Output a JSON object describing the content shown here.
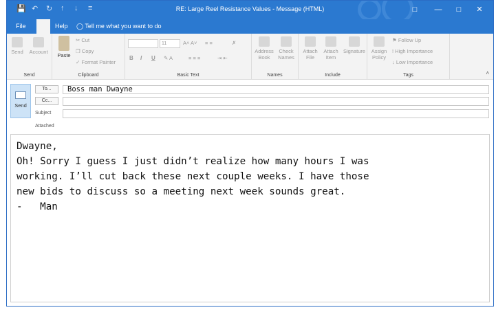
{
  "window": {
    "title": "RE: Large Reel Resistance Values - Message (HTML)",
    "quick_access": [
      "save-icon",
      "undo-icon",
      "redo-icon",
      "up-arrow-icon",
      "down-arrow-icon",
      "customize-icon"
    ],
    "accent_color": "#2b79d0"
  },
  "tabs": {
    "file": "File",
    "help": "Help",
    "tell_me": "Tell me what you want to do"
  },
  "ribbon": {
    "send_group": {
      "label": "Send",
      "send": "Send",
      "account": "Account"
    },
    "clipboard": {
      "label": "Clipboard",
      "paste": "Paste",
      "cut": "Cut",
      "copy": "Copy",
      "format_painter": "Format Painter"
    },
    "basic_text": {
      "label": "Basic Text",
      "font_size": "11",
      "bold": "B",
      "italic": "I",
      "underline": "U"
    },
    "names": {
      "label": "Names",
      "address_book_1": "Address",
      "address_book_2": "Book",
      "check_names_1": "Check",
      "check_names_2": "Names"
    },
    "include": {
      "label": "Include",
      "attach_file_1": "Attach",
      "attach_file_2": "File",
      "attach_item_1": "Attach",
      "attach_item_2": "Item",
      "signature": "Signature"
    },
    "tags": {
      "label": "Tags",
      "assign_policy_1": "Assign",
      "assign_policy_2": "Policy",
      "follow_up": "Follow Up",
      "high_importance": "High Importance",
      "low_importance": "Low Importance"
    }
  },
  "header": {
    "send": "Send",
    "to_button": "To...",
    "cc_button": "Cc...",
    "subject_label": "Subject",
    "attached_label": "Attached",
    "to_value": "Boss man Dwayne",
    "cc_value": "",
    "subject_value": ""
  },
  "body": {
    "lines": [
      "Dwayne,",
      "Oh! Sorry I guess I just didn’t realize how many hours I was",
      "working. I’ll cut back these next couple weeks. I have those",
      "new bids to discuss so a meeting next week sounds great.",
      "-   Man"
    ]
  }
}
